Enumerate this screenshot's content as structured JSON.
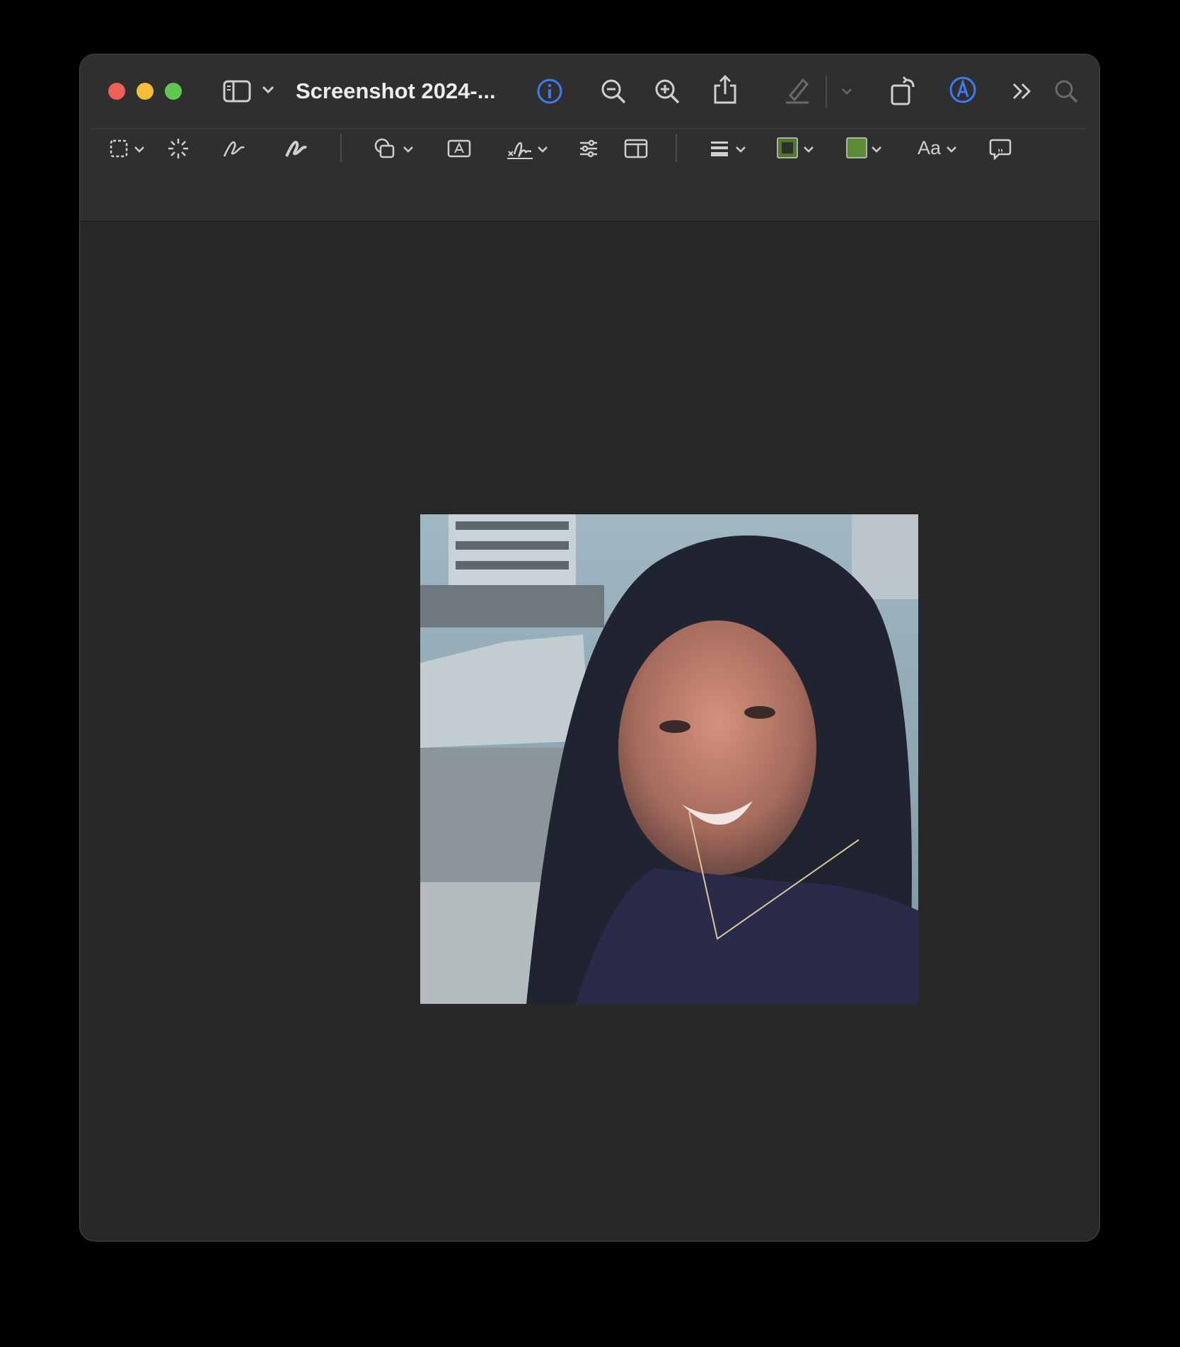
{
  "window": {
    "title": "Screenshot 2024-...",
    "accent_color": "#3e7bf2"
  },
  "toolbar": {
    "top_icons": [
      "sidebar-icon",
      "chevron-down-icon",
      "info-icon",
      "zoom-out-icon",
      "zoom-in-icon",
      "share-icon",
      "highlight-pen-icon",
      "chevron-down-icon",
      "rotate-icon",
      "markup-icon",
      "more-icon",
      "search-icon"
    ],
    "markup_icons": [
      "selection-icon",
      "instant-alpha-icon",
      "sketch-icon",
      "draw-icon",
      "shapes-icon",
      "text-box-icon",
      "signature-icon",
      "adjust-color-icon",
      "page-layout-icon",
      "line-style-icon",
      "border-color-icon",
      "fill-color-icon",
      "font-icon",
      "note-icon"
    ],
    "font_button_label": "Aa",
    "border_color": "#4f7a2d",
    "fill_color": "#5c8a35"
  },
  "image": {
    "description_icon": "photo"
  }
}
